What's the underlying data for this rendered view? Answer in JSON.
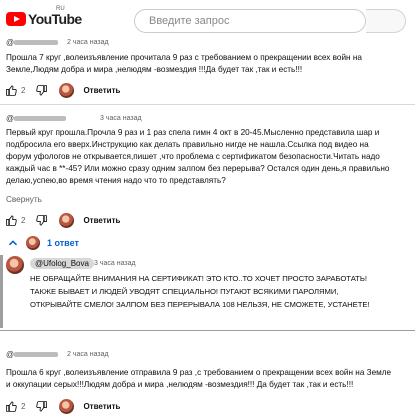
{
  "header": {
    "logo_text": "YouTube",
    "logo_region": "RU",
    "search_placeholder": "Введите запрос"
  },
  "comments": [
    {
      "author_prefix": "@",
      "time": "2 часа назад",
      "lines": [
        "Прошла 7 круг ,волеизъявление прочитала 9 раз с требованием о прекращении всех войн на",
        "Земле,Людям добра и мира ,нелюдям -возмездия !!!Да будет так ,так и есть!!!"
      ],
      "likes": "2",
      "reply_label": "Ответить"
    },
    {
      "author_prefix": "@",
      "time": "3 часа назад",
      "lines": [
        "Первый круг прошла.Прочла 9 раз и 1 раз спела гимн 4 окт в 20-45.Мысленно представила шар и",
        "подбросила его вверх.Инструкцию как делать правильно нигде не нашла.Ссылка под видео на",
        "форум уфологов не открывается,пишет ,что проблема с сертификатом безопасности.Читать надо",
        "каждый час в **-45? Или можно сразу одним залпом без перерыва? Остался один день,я правильно",
        "делаю,успею,во время чтения надо что то представлять?"
      ],
      "collapse_label": "Свернуть",
      "likes": "2",
      "reply_label": "Ответить"
    },
    {
      "author_prefix": "@",
      "time": "2 часа назад",
      "lines": [
        "Прошла 6 круг ,волеизъявление отправила 9 раз ,с требованием о прекращении всех войн на Земле",
        "и оккупации серых!!!Людям добра и мира ,нелюдям -возмездия!!! Да будет так ,так и есть!!!"
      ],
      "likes": "2",
      "reply_label": "Ответить"
    }
  ],
  "thread": {
    "label": "1 ответ"
  },
  "reply": {
    "author": "@Ufolog_Bova",
    "time": "3 часа назад",
    "lines": [
      "НЕ ОБРАЩАЙТЕ ВНИМАНИЯ НА СЕРТИФИКАТ!  ЭТО КТО..ТО ХОЧЕТ ПРОСТО ЗАРАБОТАТЬ!",
      "ТАКЖЕ БЫВАЕТ И ЛЮДЕЙ УВОДЯТ СПЕЦИАЛЬНО! ПУГАЮТ ВСЯКИМИ ПАРОЛЯМИ,",
      "ОТКРЫВАЙТЕ СМЕЛО! ЗАЛПОМ БЕЗ ПЕРЕРЫВАЛА 108 НЕЛЬЗЯ, НЕ СМОЖЕТЕ, УСТАНЕТЕ!"
    ]
  }
}
